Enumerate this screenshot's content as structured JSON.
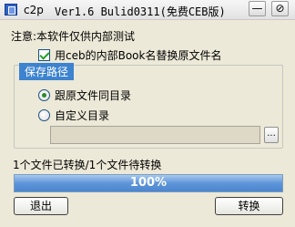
{
  "window": {
    "app_name": "c2p",
    "title": "Ver1.6 Bulid0311(免费CEB版)",
    "minimize_glyph": "—",
    "close_glyph": "⊘"
  },
  "notice": "注意:本软件仅供内部测试",
  "option_checkbox": {
    "label": "用ceb的内部Book名替换原文件名",
    "checked": true
  },
  "save_path_group": {
    "title": "保存路径",
    "options": [
      {
        "label": "跟原文件同目录",
        "selected": true
      },
      {
        "label": "自定义目录",
        "selected": false
      }
    ],
    "path_value": "",
    "browse_label": "..."
  },
  "status": "1个文件已转换/1个文件待转换",
  "progress": {
    "value": 1.0,
    "label": "100%"
  },
  "buttons": {
    "exit_label": "退出",
    "convert_label": "转换"
  },
  "colors": {
    "window_bg": "#ece9d8",
    "group_title_bg": "#3d83cf",
    "progress_blue": "#4c86d0"
  }
}
